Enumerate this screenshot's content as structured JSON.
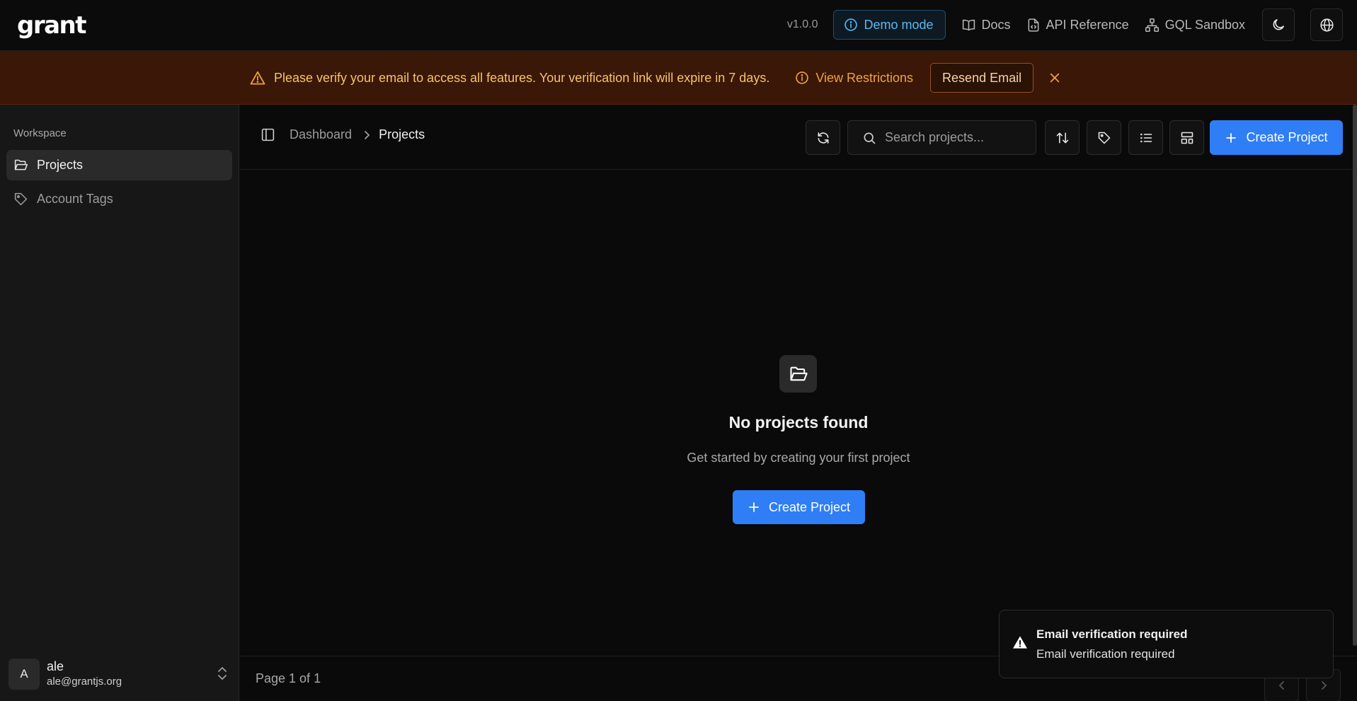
{
  "header": {
    "logo": "grant",
    "version": "v1.0.0",
    "demo_mode_label": "Demo mode",
    "links": {
      "docs": "Docs",
      "api_reference": "API Reference",
      "gql_sandbox": "GQL Sandbox"
    },
    "icons": {
      "theme": "moon-icon",
      "language": "globe-icon"
    }
  },
  "banner": {
    "message": "Please verify your email to access all features. Your verification link will expire in 7 days.",
    "view_restrictions": "View Restrictions",
    "resend_email": "Resend Email",
    "close": "✕",
    "colors": {
      "background": "#3a1706",
      "text": "#f5c46a",
      "accent": "#f0a43a"
    }
  },
  "sidebar": {
    "section_heading": "Workspace",
    "items": [
      {
        "label": "Projects",
        "icon": "folder-open-icon",
        "active": true
      },
      {
        "label": "Account Tags",
        "icon": "tag-icon",
        "active": false
      }
    ],
    "user": {
      "initial": "A",
      "name": "ale",
      "email": "ale@grantjs.org"
    }
  },
  "main": {
    "breadcrumb": [
      "Dashboard",
      "Projects"
    ],
    "search_placeholder": "Search projects...",
    "create_project_label": "Create Project",
    "empty_state": {
      "title": "No projects found",
      "subtitle": "Get started by creating your first project",
      "button_label": "Create Project"
    },
    "pagination": {
      "label": "Page 1 of 1"
    }
  },
  "toast": {
    "title": "Email verification required",
    "description": "Email verification required"
  },
  "colors": {
    "primary": "#2f7ef6",
    "demo_badge": "#5bb8f0"
  }
}
